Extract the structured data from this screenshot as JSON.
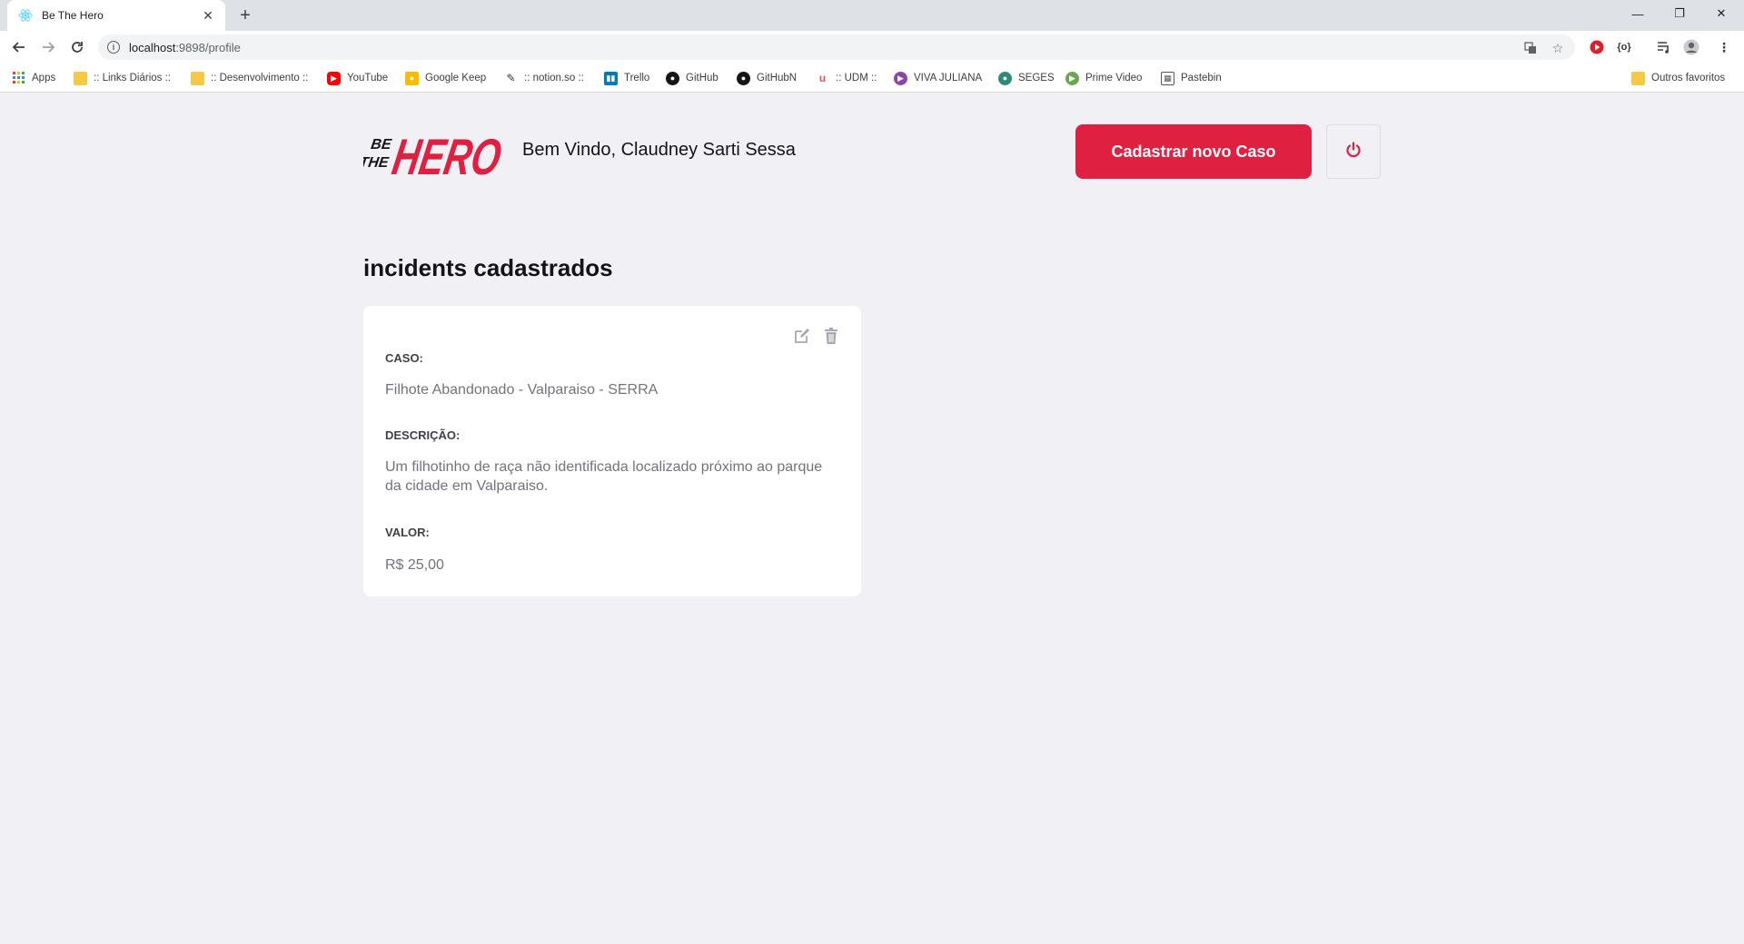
{
  "browser": {
    "tab_title": "Be The Hero",
    "url_host": "localhost",
    "url_path": ":9898/profile",
    "bookmarks": [
      {
        "label": "Apps",
        "icon": "apps-grid-icon"
      },
      {
        "label": ":: Links Diários ::",
        "icon": "folder-icon"
      },
      {
        "label": ":: Desenvolvimento ::",
        "icon": "folder-icon"
      },
      {
        "label": "YouTube",
        "icon": "youtube-icon"
      },
      {
        "label": "Google Keep",
        "icon": "keep-icon"
      },
      {
        "label": ":: notion.so ::",
        "icon": "notion-icon"
      },
      {
        "label": "Trello",
        "icon": "trello-icon"
      },
      {
        "label": "GitHub",
        "icon": "github-icon"
      },
      {
        "label": "GitHubN",
        "icon": "github-icon"
      },
      {
        "label": ":: UDM ::",
        "icon": "udemy-icon"
      },
      {
        "label": "VIVA JULIANA",
        "icon": "play-icon"
      },
      {
        "label": "SEGES",
        "icon": "seges-icon"
      },
      {
        "label": "Prime Video",
        "icon": "prime-video-icon"
      },
      {
        "label": "Pastebin",
        "icon": "pastebin-icon"
      }
    ],
    "other_bookmarks": "Outros favoritos"
  },
  "header": {
    "logo_text": "BE THE HERO",
    "welcome": "Bem Vindo, Claudney Sarti Sessa",
    "new_case_label": "Cadastrar novo Caso"
  },
  "incidents": {
    "title": "incidents cadastrados",
    "items": [
      {
        "case_label": "CASO:",
        "case_value": "Filhote Abandonado - Valparaiso - SERRA",
        "description_label": "DESCRIÇÃO:",
        "description_value": "Um filhotinho de raça não identificada localizado próximo ao parque da cidade em Valparaiso.",
        "value_label": "VALOR:",
        "value_value": "R$ 25,00"
      }
    ]
  },
  "colors": {
    "accent": "#e02041",
    "background": "#f0f0f5",
    "text_dark": "#13131a",
    "text_muted": "#737380"
  }
}
